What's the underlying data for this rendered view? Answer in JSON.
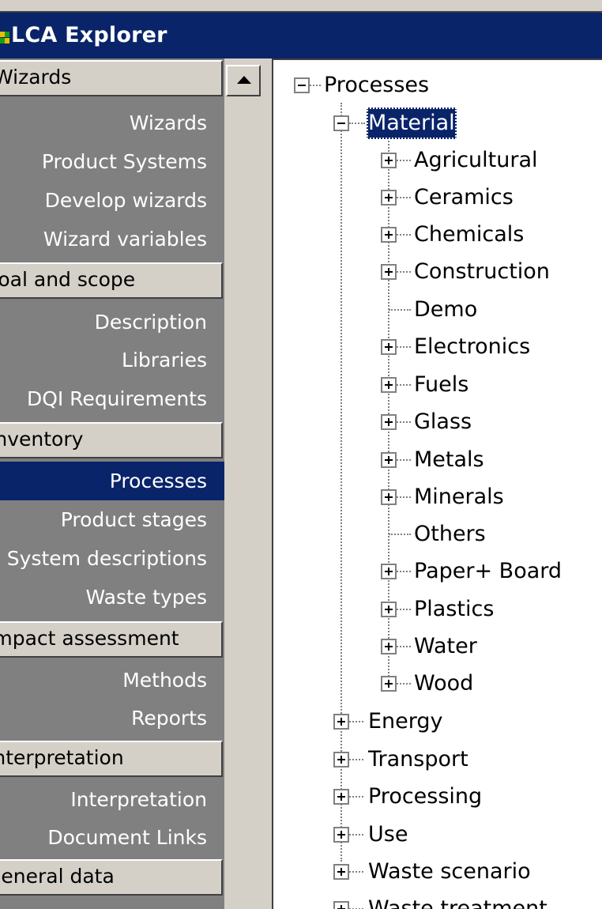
{
  "window": {
    "title": "LCA Explorer"
  },
  "sidebar": {
    "groups": [
      {
        "label": "Wizards",
        "items": [
          "Wizards",
          "Product Systems",
          "Develop wizards",
          "Wizard variables"
        ]
      },
      {
        "label": "Goal and scope",
        "items": [
          "Description",
          "Libraries",
          "DQI Requirements"
        ]
      },
      {
        "label": "Inventory",
        "items": [
          "Processes",
          "Product stages",
          "System descriptions",
          "Waste types"
        ]
      },
      {
        "label": "Impact assessment",
        "items": [
          "Methods",
          "Reports"
        ]
      },
      {
        "label": "Interpretation",
        "items": [
          "Interpretation",
          "Document Links"
        ]
      },
      {
        "label": "General data",
        "items": []
      }
    ],
    "selected_item": "Processes"
  },
  "tree": {
    "root": "Processes",
    "material": {
      "label": "Material",
      "children": [
        "Agricultural",
        "Ceramics",
        "Chemicals",
        "Construction",
        "Demo",
        "Electronics",
        "Fuels",
        "Glass",
        "Metals",
        "Minerals",
        "Others",
        "Paper+ Board",
        "Plastics",
        "Water",
        "Wood"
      ]
    },
    "top_level": [
      "Energy",
      "Transport",
      "Processing",
      "Use",
      "Waste scenario",
      "Waste treatment"
    ]
  },
  "colors": {
    "titlebar": "#0a246a",
    "selection": "#0a246a",
    "sidebar_bg": "#808080",
    "chrome": "#d4d0c8"
  }
}
